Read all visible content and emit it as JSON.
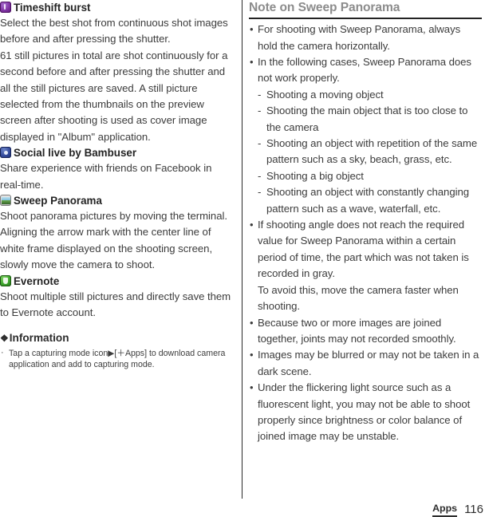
{
  "page": {
    "footer_tab": "Apps",
    "page_number": "116"
  },
  "left_column": {
    "features": [
      {
        "icon": "timeshift-burst-icon",
        "title": "Timeshift burst",
        "paragraphs": [
          "Select the best shot from continuous shot images before and after pressing the shutter.",
          "61 still pictures in total are shot continuously for a second before and after pressing the shutter and all the still pictures are saved. A still picture selected from the thumbnails on the preview screen after shooting is used as cover image displayed in \"Album\" application."
        ]
      },
      {
        "icon": "social-live-by-bambuser-icon",
        "title": "Social live by Bambuser",
        "paragraphs": [
          "Share experience with friends on Facebook in real-time."
        ]
      },
      {
        "icon": "sweep-panorama-icon",
        "title": "Sweep Panorama",
        "paragraphs": [
          "Shoot panorama pictures by moving the terminal.",
          "Aligning the arrow mark with the center line of white frame displayed on the shooting screen, slowly move the camera to shoot."
        ]
      },
      {
        "icon": "evernote-icon",
        "title": "Evernote",
        "paragraphs": [
          "Shoot multiple still pictures and directly save them to Evernote account."
        ]
      }
    ],
    "information": {
      "marker": "❖",
      "heading": "Information",
      "bullet": "·",
      "items": [
        "Tap a capturing mode icon▶[＋Apps] to download camera application and add to capturing mode."
      ]
    }
  },
  "right_column": {
    "title": "Note on Sweep Panorama",
    "bullet": "•",
    "dash": "-",
    "notes": [
      {
        "text": "For shooting with Sweep Panorama, always hold the camera horizontally.",
        "sub": []
      },
      {
        "text": "In the following cases, Sweep Panorama does not work properly.",
        "sub": [
          "Shooting a moving object",
          "Shooting the main object that is too close to the camera",
          "Shooting an object with repetition of the same pattern such as a sky, beach, grass, etc.",
          "Shooting a big object",
          "Shooting an object with constantly changing pattern such as a wave, waterfall, etc."
        ]
      },
      {
        "text": "If shooting angle does not reach the required value for Sweep Panorama within a certain period of time, the part which was not taken is recorded in gray.\nTo avoid this, move the camera faster when shooting.",
        "sub": []
      },
      {
        "text": "Because two or more images are joined together, joints may not recorded smoothly.",
        "sub": []
      },
      {
        "text": "Images may be blurred or may not be taken in a dark scene.",
        "sub": []
      },
      {
        "text": "Under the flickering light source such as a fluorescent light, you may not be able to shoot properly since brightness or color balance of joined image may be unstable.",
        "sub": []
      }
    ]
  }
}
